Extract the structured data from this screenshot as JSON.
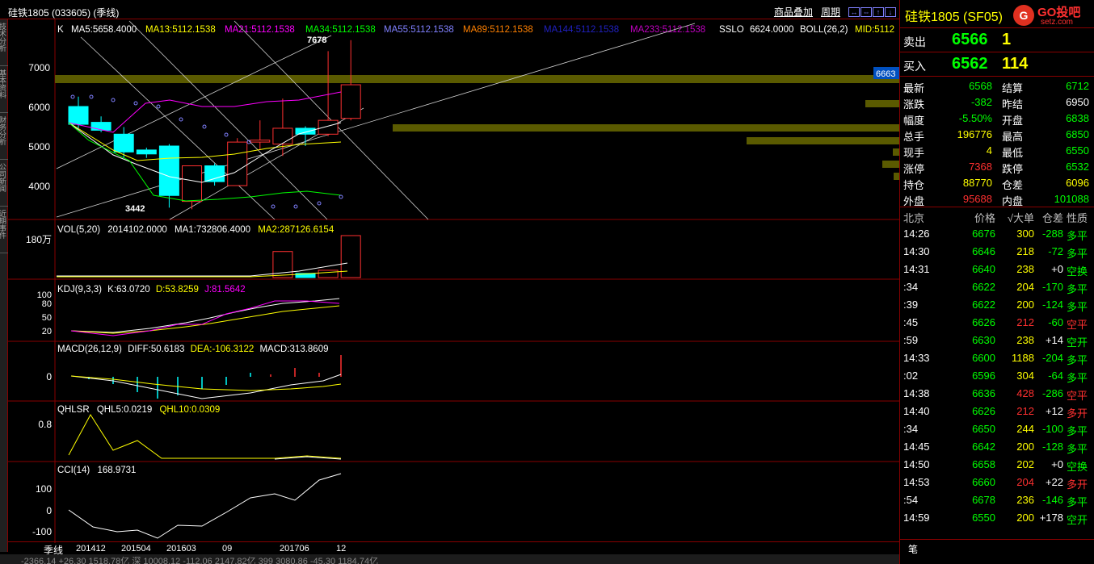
{
  "title": "硅铁1805 (033605) (季线)",
  "toolbar": {
    "overlay": "商品叠加",
    "period": "周期",
    "btn1": "↔",
    "btn2": "⇔",
    "btn3": "↑",
    "btn4": "↓"
  },
  "left_tabs": [
    "技术分析",
    "基本资料",
    "财务分析",
    "公司新闻",
    "近期事件"
  ],
  "main_panel": {
    "label_k": "K",
    "ma": [
      {
        "text": "MA5:5658.4000",
        "color": "#ffffff"
      },
      {
        "text": "MA13:5112.1538",
        "color": "#ffff00"
      },
      {
        "text": "MA21:5112.1538",
        "color": "#ff00ff"
      },
      {
        "text": "MA34:5112.1538",
        "color": "#00ff00"
      },
      {
        "text": "MA55:5112.1538",
        "color": "#8080ff"
      },
      {
        "text": "MA89:5112.1538",
        "color": "#ff8000"
      },
      {
        "text": "MA144:5112.1538",
        "color": "#2020c0"
      },
      {
        "text": "MA233:5112.1538",
        "color": "#c000c0"
      },
      {
        "text": "SSLO",
        "color": "#ffffff"
      },
      {
        "text": "6624.0000",
        "color": "#ffffff"
      },
      {
        "text": "BOLL(26,2)",
        "color": "#ffffff"
      },
      {
        "text": "MID:5112",
        "color": "#ffff00"
      }
    ],
    "yticks": [
      "7000",
      "6000",
      "5000",
      "4000"
    ],
    "high_label": "7678",
    "low_label": "3442",
    "price_tag": "6663"
  },
  "vol_panel": {
    "label": "VOL(5,20)",
    "v1": "2014102.0000",
    "v2": "MA1:732806.4000",
    "v3": "MA2:287126.6154",
    "ytick": "180万"
  },
  "kdj_panel": {
    "label": "KDJ(9,3,3)",
    "k": "K:63.0720",
    "d": "D:53.8259",
    "j": "J:81.5642",
    "yticks": [
      "100",
      "80",
      "50",
      "20"
    ]
  },
  "macd_panel": {
    "label": "MACD(26,12,9)",
    "diff": "DIFF:50.6183",
    "dea": "DEA:-106.3122",
    "macd": "MACD:313.8609",
    "ytick": "0"
  },
  "qhl_panel": {
    "label": "QHLSR",
    "q5": "QHL5:0.0219",
    "q10": "QHL10:0.0309",
    "ytick": "0.8"
  },
  "cci_panel": {
    "label": "CCI(14)",
    "val": "168.9731",
    "yticks": [
      "100",
      "0",
      "-100"
    ]
  },
  "xaxis": {
    "name": "季线",
    "ticks": [
      "201412",
      "201504",
      "201603",
      "09",
      "201706",
      "12"
    ]
  },
  "status_line": "-2366.14   +26.30  1518.78亿   深 10008.12  -112.06  2147.82亿   399 3080.86  -45.30  1184.74亿",
  "side": {
    "header": "硅铁1805 (SF05)",
    "logo_mark": "G",
    "logo_brand": "GO投吧",
    "logo_url": "setz.com",
    "sell_label": "卖出",
    "sell_price": "6566",
    "sell_vol": "1",
    "buy_label": "买入",
    "buy_price": "6562",
    "buy_vol": "114",
    "stats": [
      {
        "k1": "最新",
        "v1": "6568",
        "c1": "g",
        "k2": "结算",
        "v2": "6712",
        "c2": "g"
      },
      {
        "k1": "涨跌",
        "v1": "-382",
        "c1": "g",
        "k2": "昨结",
        "v2": "6950",
        "c2": "w"
      },
      {
        "k1": "幅度",
        "v1": "-5.50%",
        "c1": "g",
        "k2": "开盘",
        "v2": "6838",
        "c2": "g"
      },
      {
        "k1": "总手",
        "v1": "196776",
        "c1": "y",
        "k2": "最高",
        "v2": "6850",
        "c2": "g"
      },
      {
        "k1": "现手",
        "v1": "4",
        "c1": "y",
        "k2": "最低",
        "v2": "6550",
        "c2": "g"
      },
      {
        "k1": "涨停",
        "v1": "7368",
        "c1": "r",
        "k2": "跌停",
        "v2": "6532",
        "c2": "g"
      },
      {
        "k1": "持仓",
        "v1": "88770",
        "c1": "y",
        "k2": "仓差",
        "v2": "6096",
        "c2": "y"
      },
      {
        "k1": "外盘",
        "v1": "95688",
        "c1": "r",
        "k2": "内盘",
        "v2": "101088",
        "c2": "g"
      }
    ],
    "tick_header": {
      "t": "北京",
      "p": "价格",
      "v": "√大单",
      "d": "仓差",
      "n": "性质"
    },
    "ticks": [
      {
        "t": "14:26",
        "p": "6676",
        "pc": "g",
        "v": "300",
        "vc": "y",
        "d": "-288",
        "n": "多平",
        "nc": "g"
      },
      {
        "t": "14:30",
        "p": "6646",
        "pc": "g",
        "v": "218",
        "vc": "y",
        "d": "-72",
        "n": "多平",
        "nc": "g"
      },
      {
        "t": "14:31",
        "p": "6640",
        "pc": "g",
        "v": "238",
        "vc": "y",
        "d": "+0",
        "n": "空换",
        "nc": "g"
      },
      {
        "t": ":34",
        "p": "6622",
        "pc": "g",
        "v": "204",
        "vc": "y",
        "d": "-170",
        "n": "多平",
        "nc": "g"
      },
      {
        "t": ":39",
        "p": "6622",
        "pc": "g",
        "v": "200",
        "vc": "y",
        "d": "-124",
        "n": "多平",
        "nc": "g"
      },
      {
        "t": ":45",
        "p": "6626",
        "pc": "g",
        "v": "212",
        "vc": "r",
        "d": "-60",
        "n": "空平",
        "nc": "r"
      },
      {
        "t": ":59",
        "p": "6630",
        "pc": "g",
        "v": "238",
        "vc": "y",
        "d": "+14",
        "n": "空开",
        "nc": "g"
      },
      {
        "t": "14:33",
        "p": "6600",
        "pc": "g",
        "v": "1188",
        "vc": "y",
        "d": "-204",
        "n": "多平",
        "nc": "g"
      },
      {
        "t": ":02",
        "p": "6596",
        "pc": "g",
        "v": "304",
        "vc": "y",
        "d": "-64",
        "n": "多平",
        "nc": "g"
      },
      {
        "t": "14:38",
        "p": "6636",
        "pc": "g",
        "v": "428",
        "vc": "r",
        "d": "-286",
        "n": "空平",
        "nc": "r"
      },
      {
        "t": "14:40",
        "p": "6626",
        "pc": "g",
        "v": "212",
        "vc": "r",
        "d": "+12",
        "n": "多开",
        "nc": "r"
      },
      {
        "t": ":34",
        "p": "6650",
        "pc": "g",
        "v": "244",
        "vc": "y",
        "d": "-100",
        "n": "多平",
        "nc": "g"
      },
      {
        "t": "14:45",
        "p": "6642",
        "pc": "g",
        "v": "200",
        "vc": "y",
        "d": "-128",
        "n": "多平",
        "nc": "g"
      },
      {
        "t": "14:50",
        "p": "6658",
        "pc": "g",
        "v": "202",
        "vc": "y",
        "d": "+0",
        "n": "空换",
        "nc": "g"
      },
      {
        "t": "14:53",
        "p": "6660",
        "pc": "g",
        "v": "204",
        "vc": "r",
        "d": "+22",
        "n": "多开",
        "nc": "r"
      },
      {
        "t": ":54",
        "p": "6678",
        "pc": "g",
        "v": "236",
        "vc": "y",
        "d": "-146",
        "n": "多平",
        "nc": "g"
      },
      {
        "t": "14:59",
        "p": "6550",
        "pc": "g",
        "v": "200",
        "vc": "y",
        "d": "+178",
        "n": "空开",
        "nc": "g"
      }
    ],
    "footer_tab": "笔"
  },
  "candles": [
    {
      "o": 6000,
      "h": 6250,
      "l": 5450,
      "c": 5550
    },
    {
      "o": 5600,
      "h": 5750,
      "l": 5350,
      "c": 5400
    },
    {
      "o": 5300,
      "h": 5480,
      "l": 4700,
      "c": 4850
    },
    {
      "o": 4900,
      "h": 4960,
      "l": 4700,
      "c": 4800
    },
    {
      "o": 5000,
      "h": 5050,
      "l": 3442,
      "c": 3750
    },
    {
      "o": 3600,
      "h": 4500,
      "l": 3400,
      "c": 4500
    },
    {
      "o": 4500,
      "h": 4560,
      "l": 4000,
      "c": 4100
    },
    {
      "o": 4000,
      "h": 5200,
      "l": 4000,
      "c": 5100
    },
    {
      "o": 5100,
      "h": 5650,
      "l": 4900,
      "c": 5150
    },
    {
      "o": 5050,
      "h": 6200,
      "l": 4750,
      "c": 5450
    },
    {
      "o": 5450,
      "h": 5500,
      "l": 5000,
      "c": 5300
    },
    {
      "o": 5300,
      "h": 7400,
      "l": 5250,
      "c": 5650
    },
    {
      "o": 5700,
      "h": 7678,
      "l": 5650,
      "c": 6550
    }
  ],
  "volumes": [
    0,
    0,
    0,
    0,
    0,
    0,
    0,
    0,
    0,
    1250000,
    200000,
    350000,
    2014102
  ]
}
